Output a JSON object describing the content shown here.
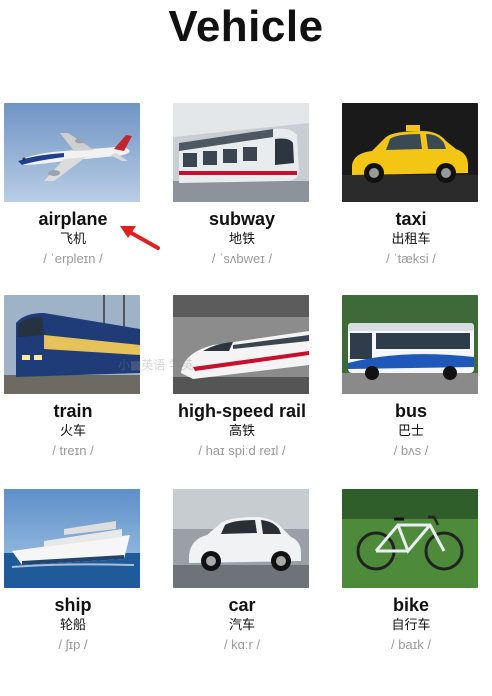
{
  "title": "Vehicle",
  "items": [
    {
      "en": "airplane",
      "cn": "飞机",
      "ph": "/ ˈerpleɪn /",
      "icon": "airplane-photo"
    },
    {
      "en": "subway",
      "cn": "地铁",
      "ph": "/ ˈsʌbweɪ /",
      "icon": "subway-photo"
    },
    {
      "en": "taxi",
      "cn": "出租车",
      "ph": "/ ˈtæksi /",
      "icon": "taxi-photo"
    },
    {
      "en": "train",
      "cn": "火车",
      "ph": "/ treɪn /",
      "icon": "train-photo"
    },
    {
      "en": "high-speed rail",
      "cn": "高铁",
      "ph": "/ haɪ spiːd reɪl /",
      "icon": "high-speed-rail-photo"
    },
    {
      "en": "bus",
      "cn": "巴士",
      "ph": "/ bʌs /",
      "icon": "bus-photo"
    },
    {
      "en": "ship",
      "cn": "轮船",
      "ph": "/ ʃɪp /",
      "icon": "ship-photo"
    },
    {
      "en": "car",
      "cn": "汽车",
      "ph": "/ kɑːr /",
      "icon": "car-photo"
    },
    {
      "en": "bike",
      "cn": "自行车",
      "ph": "/ baɪk /",
      "icon": "bike-photo"
    }
  ],
  "watermark": "小■英语 学英",
  "colors": {
    "arrow": "#e02020",
    "phonetic": "#9a9a9a"
  }
}
